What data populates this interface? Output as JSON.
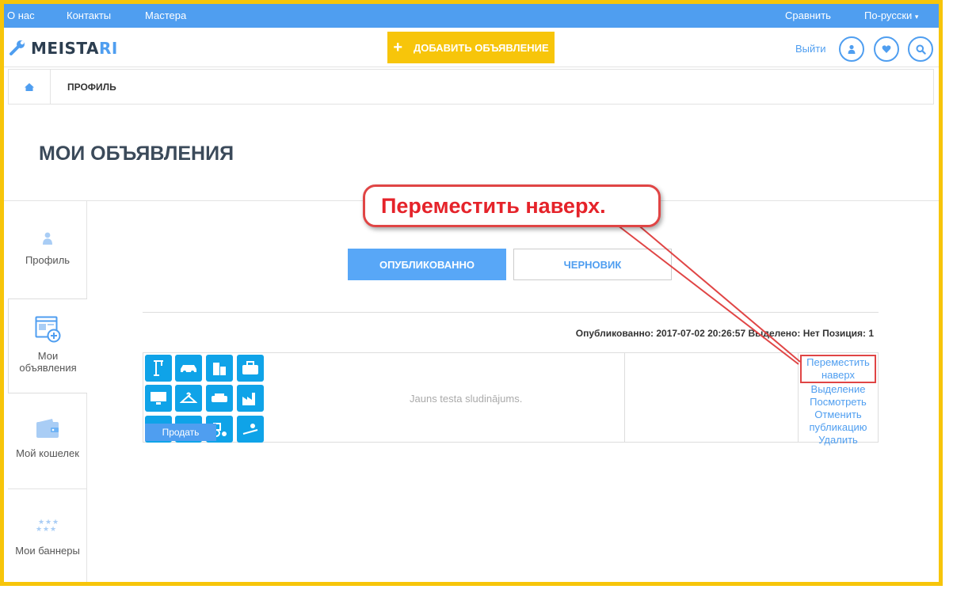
{
  "topnav": {
    "about": "О нас",
    "contacts": "Контакты",
    "masters": "Мастера",
    "compare": "Сравнить",
    "language": "По-русски"
  },
  "header": {
    "logo_main": "MEISTA",
    "logo_accent": "RI",
    "add_listing": "ДОБАВИТЬ ОБЪЯВЛЕНИЕ",
    "logout": "Выйти"
  },
  "breadcrumb": {
    "current": "ПРОФИЛЬ"
  },
  "page": {
    "title": "МОИ ОБЪЯВЛЕНИЯ"
  },
  "sidebar": {
    "items": [
      {
        "label": "Профиль",
        "icon": "user-icon"
      },
      {
        "label": "Мои объявления",
        "icon": "ads-icon"
      },
      {
        "label": "Мой кошелек",
        "icon": "wallet-icon"
      },
      {
        "label": "Мои баннеры",
        "icon": "stars-icon"
      }
    ]
  },
  "tabs": {
    "published": "ОПУБЛИКОВАННО",
    "draft": "ЧЕРНОВИК"
  },
  "listing": {
    "meta": "Опубликованно: 2017-07-02 20:26:57 Выделено: Нет Позиция: 1",
    "title": "Jauns testa sludinājums.",
    "badge": "Продать",
    "actions": {
      "move_top_1": "Переместить",
      "move_top_2": "наверх",
      "highlight": "Выделение",
      "view": "Посмотреть",
      "unpublish_1": "Отменить",
      "unpublish_2": "публикацию",
      "delete": "Удалить"
    }
  },
  "annotation": {
    "text": "Переместить наверх."
  },
  "colors": {
    "accent": "#4f9ef0",
    "yellow": "#f7c50a",
    "red": "#e04545",
    "tile": "#0fa3e8"
  }
}
